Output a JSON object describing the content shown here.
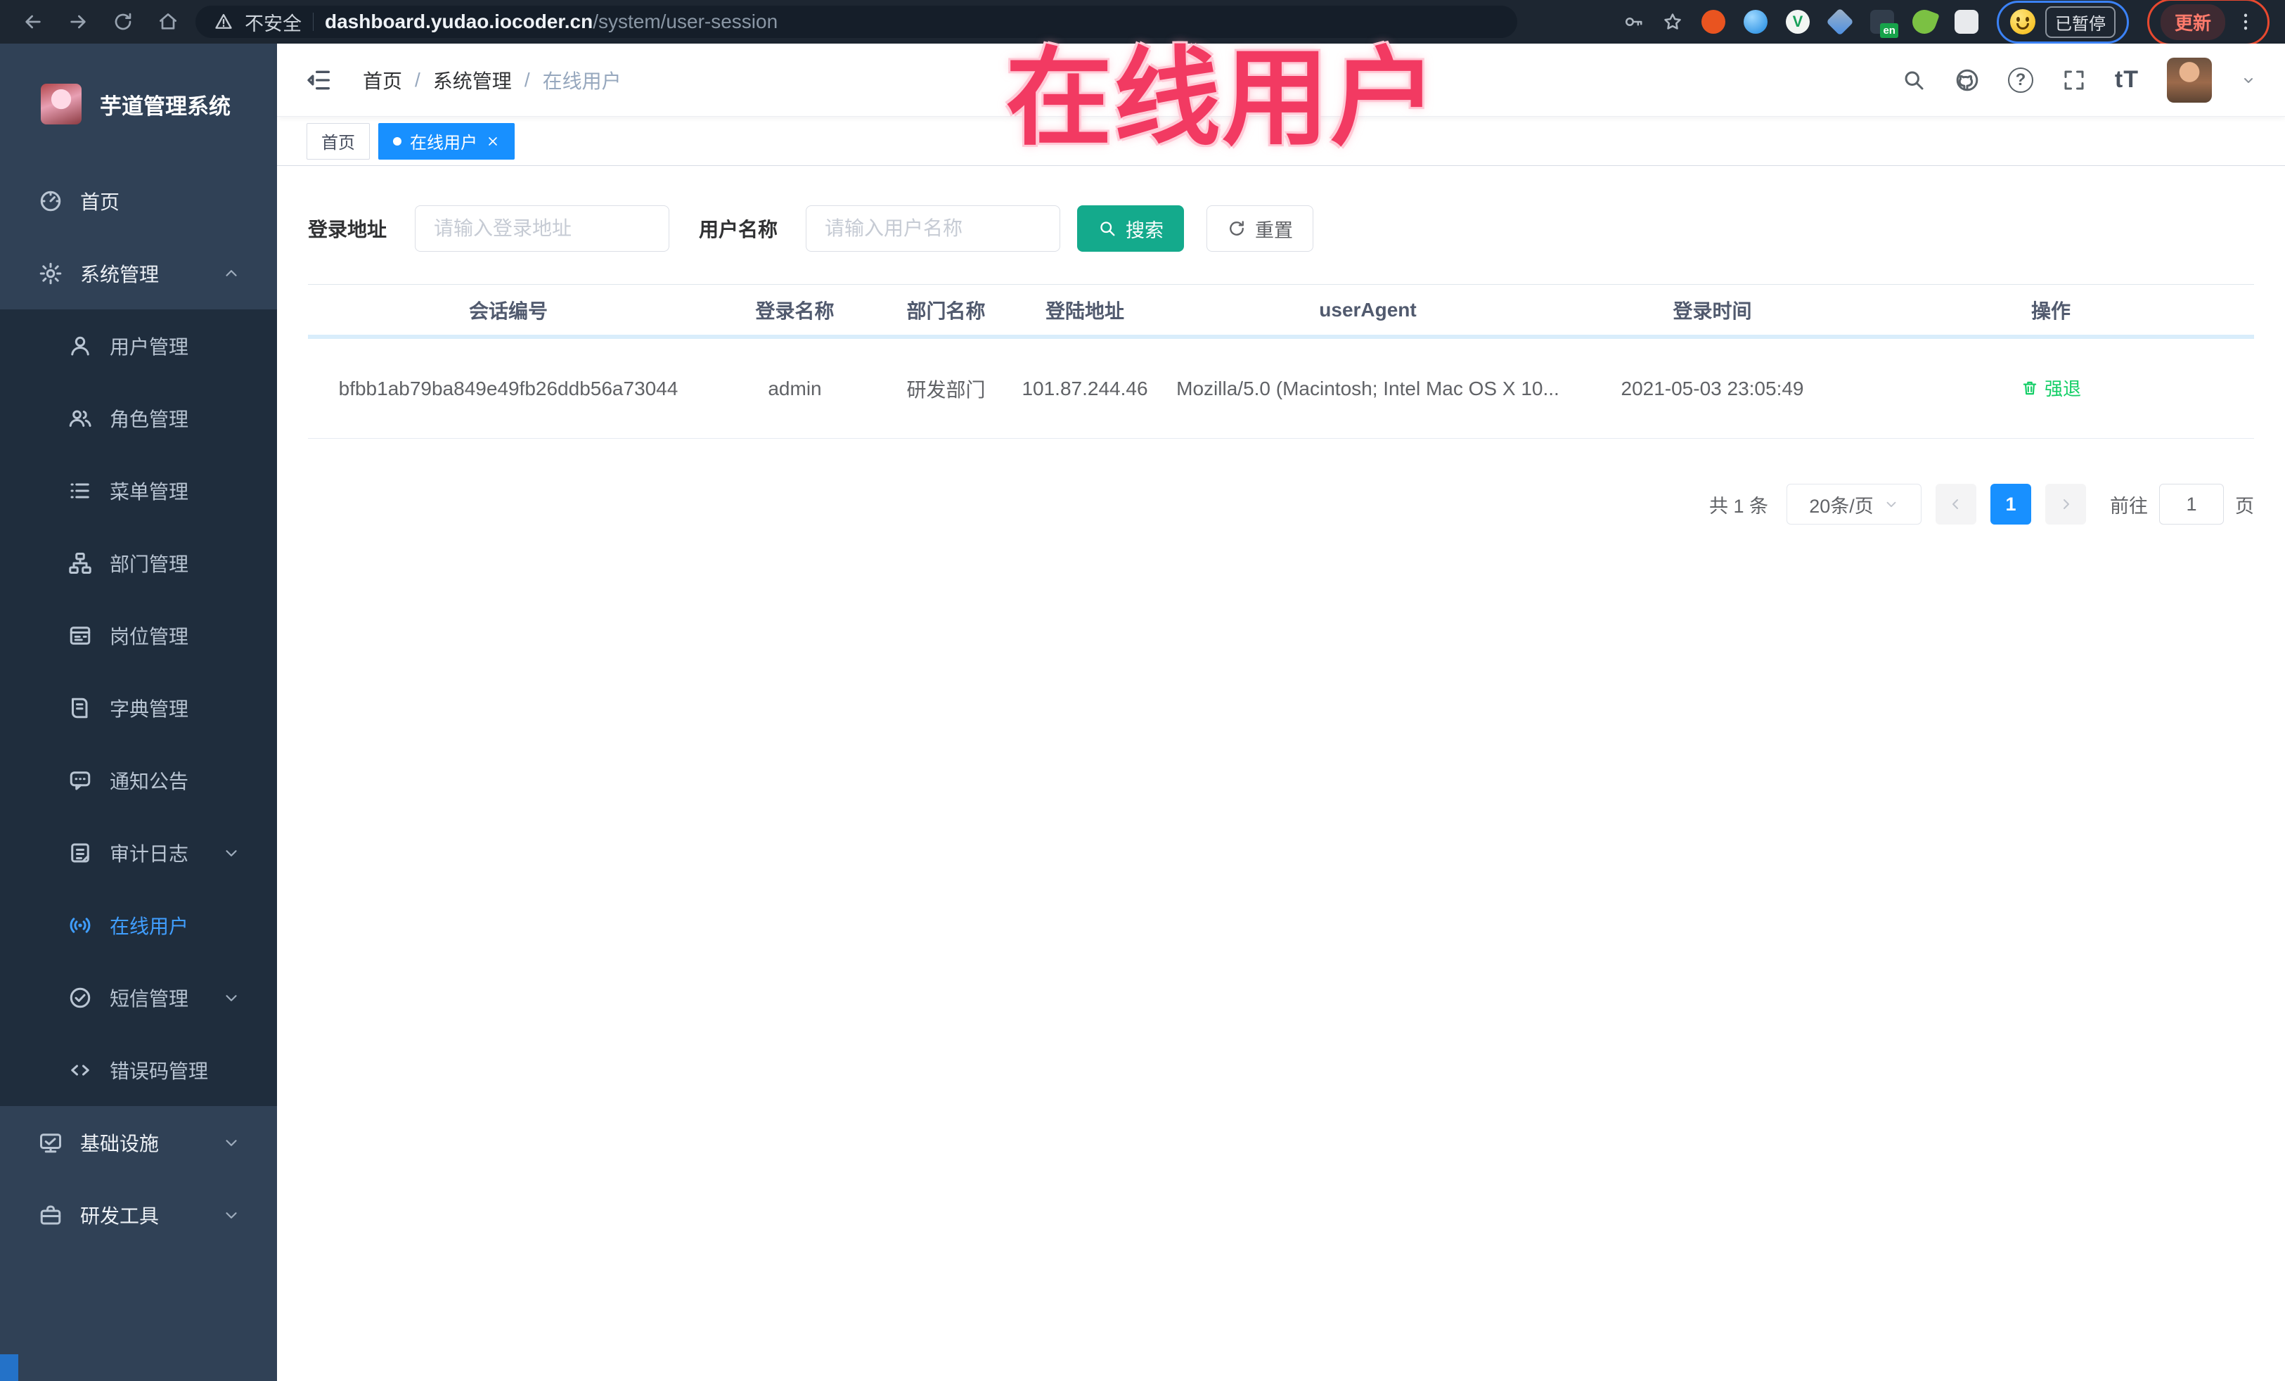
{
  "colors": {
    "accent": "#1890ff",
    "teal": "#14aa8c",
    "success": "#13ce66",
    "sidebar": "#304156",
    "submenu": "#1f2d3d",
    "watermark": "#f23a62"
  },
  "browser": {
    "security_label": "不安全",
    "url_domain": "dashboard.yudao.iocoder.cn",
    "url_path": "/system/user-session",
    "en_badge": "en",
    "paused_badge": "已暂停",
    "update_button": "更新"
  },
  "watermark": {
    "text": "在线用户"
  },
  "sidebar": {
    "app_title": "芋道管理系统",
    "items": [
      {
        "label": "首页"
      },
      {
        "label": "系统管理"
      },
      {
        "label": "用户管理"
      },
      {
        "label": "角色管理"
      },
      {
        "label": "菜单管理"
      },
      {
        "label": "部门管理"
      },
      {
        "label": "岗位管理"
      },
      {
        "label": "字典管理"
      },
      {
        "label": "通知公告"
      },
      {
        "label": "审计日志"
      },
      {
        "label": "在线用户"
      },
      {
        "label": "短信管理"
      },
      {
        "label": "错误码管理"
      },
      {
        "label": "基础设施"
      },
      {
        "label": "研发工具"
      }
    ]
  },
  "header": {
    "breadcrumb": {
      "home": "首页",
      "section": "系统管理",
      "current": "在线用户",
      "separator": "/"
    },
    "help_glyph": "?",
    "font_size_glyph": "tT"
  },
  "tabs": [
    {
      "label": "首页"
    },
    {
      "label": "在线用户"
    }
  ],
  "search": {
    "addr_label": "登录地址",
    "addr_placeholder": "请输入登录地址",
    "name_label": "用户名称",
    "name_placeholder": "请输入用户名称",
    "search_btn": "搜索",
    "reset_btn": "重置"
  },
  "table": {
    "columns": {
      "session": "会话编号",
      "username": "登录名称",
      "dept": "部门名称",
      "ip": "登陆地址",
      "agent": "userAgent",
      "time": "登录时间",
      "action": "操作"
    },
    "rows": [
      {
        "session": "bfbb1ab79ba849e49fb26ddb56a73044",
        "username": "admin",
        "dept": "研发部门",
        "ip": "101.87.244.46",
        "agent": "Mozilla/5.0 (Macintosh; Intel Mac OS X 10...",
        "time": "2021-05-03 23:05:49",
        "action": "强退"
      }
    ]
  },
  "pagination": {
    "total": "共 1 条",
    "page_size": "20条/页",
    "current_page": "1",
    "jump_prefix": "前往",
    "jump_value": "1",
    "jump_suffix": "页"
  }
}
